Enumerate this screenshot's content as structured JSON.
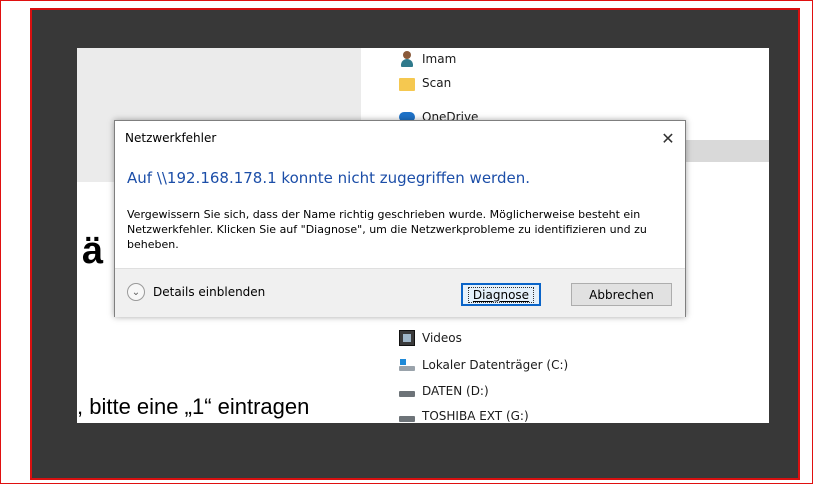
{
  "background_text": {
    "big_letter": "ä",
    "instruction": ", bitte eine „1“ eintragen"
  },
  "explorer": {
    "items_top": [
      {
        "label": "Imam",
        "icon": "user-icon"
      },
      {
        "label": "Scan",
        "icon": "folder-icon"
      },
      {
        "label": "OneDrive",
        "icon": "cloud-icon"
      }
    ],
    "items_bottom": [
      {
        "label": "Videos",
        "icon": "video-icon"
      },
      {
        "label": "Lokaler Datenträger (C:)",
        "icon": "drive-icon"
      },
      {
        "label": "DATEN (D:)",
        "icon": "drive-icon"
      },
      {
        "label": "TOSHIBA EXT (G:)",
        "icon": "drive-icon"
      }
    ]
  },
  "dialog": {
    "title": "Netzwerkfehler",
    "close_symbol": "✕",
    "heading": "Auf \\\\192.168.178.1 konnte nicht zugegriffen werden.",
    "body": "Vergewissern Sie sich, dass der Name richtig geschrieben wurde. Möglicherweise besteht ein Netzwerkfehler. Klicken Sie auf \"Diagnose\", um die Netzwerkprobleme zu identifizieren und zu beheben.",
    "details_label": "Details einblenden",
    "details_symbol": "⌄",
    "diagnose_label": "Diagnose",
    "cancel_label": "Abbrechen"
  },
  "colors": {
    "heading_blue": "#1c4ea8",
    "frame_red": "#d81010",
    "frame_dark": "#383838"
  }
}
